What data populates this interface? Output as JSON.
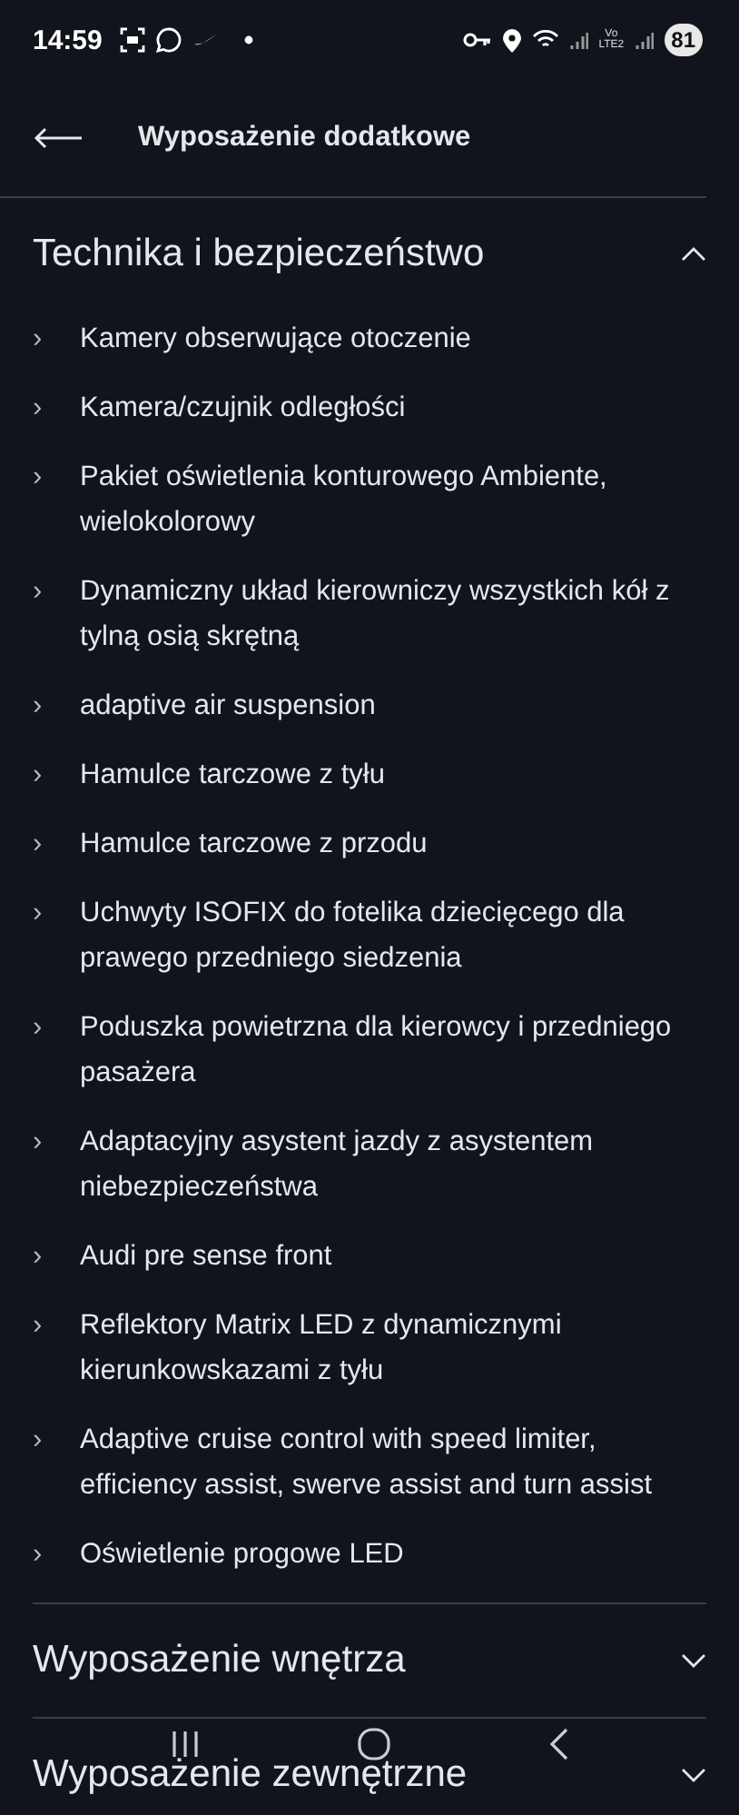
{
  "status_bar": {
    "time": "14:59",
    "volte_top": "Vo",
    "volte_bottom": "LTE2",
    "battery": "81"
  },
  "header": {
    "title": "Wyposażenie dodatkowe"
  },
  "sections": [
    {
      "title": "Technika i bezpieczeństwo",
      "expanded": true,
      "items": [
        {
          "bullet": "›",
          "text": "Kamery obserwujące otoczenie"
        },
        {
          "bullet": "›",
          "text": "Kamera/czujnik odległości"
        },
        {
          "bullet": "›",
          "text": "Pakiet oświetlenia konturowego Ambiente, wielokolorowy"
        },
        {
          "bullet": "›",
          "text": "Dynamiczny układ kierowniczy wszystkich kół z tylną osią skrętną"
        },
        {
          "bullet": "›",
          "text": "adaptive air suspension"
        },
        {
          "bullet": "›",
          "text": "Hamulce tarczowe z tyłu"
        },
        {
          "bullet": "›",
          "text": "Hamulce tarczowe z przodu"
        },
        {
          "bullet": "›",
          "text": "Uchwyty ISOFIX do fotelika dziecięcego dla prawego przedniego siedzenia"
        },
        {
          "bullet": "›",
          "text": "Poduszka powietrzna dla kierowcy i przedniego pasażera"
        },
        {
          "bullet": "›",
          "text": "Adaptacyjny asystent jazdy z asystentem niebezpieczeństwa"
        },
        {
          "bullet": "›",
          "text": "Audi pre sense front"
        },
        {
          "bullet": "›",
          "text": "Reflektory Matrix LED z dynamicznymi kierunkowskazami z tyłu"
        },
        {
          "bullet": "›",
          "text": "Adaptive cruise control with speed limiter, efficiency assist, swerve assist and turn assist"
        },
        {
          "bullet": "›",
          "text": "Oświetlenie progowe LED"
        }
      ]
    },
    {
      "title": "Wyposażenie wnętrza",
      "expanded": false
    },
    {
      "title": "Wyposażenie zewnętrzne",
      "expanded": false
    }
  ]
}
